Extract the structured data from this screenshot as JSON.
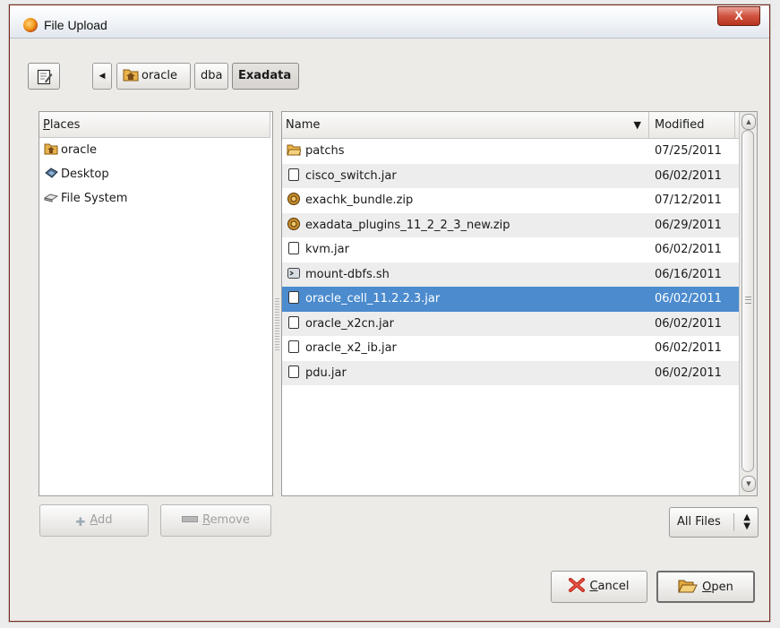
{
  "window": {
    "title": "File Upload",
    "close_label": "X"
  },
  "path_bar": {
    "crumbs": [
      {
        "label": "oracle"
      },
      {
        "label": "dba"
      },
      {
        "label": "Exadata"
      }
    ]
  },
  "places": {
    "header": "Places",
    "items": [
      {
        "label": "oracle",
        "icon": "home-folder-icon"
      },
      {
        "label": "Desktop",
        "icon": "desktop-icon"
      },
      {
        "label": "File System",
        "icon": "drive-icon"
      }
    ]
  },
  "files": {
    "columns": {
      "name": "Name",
      "modified": "Modified"
    },
    "rows": [
      {
        "name": "patchs",
        "modified": "07/25/2011",
        "icon": "folder-icon"
      },
      {
        "name": "cisco_switch.jar",
        "modified": "06/02/2011",
        "icon": "file-icon"
      },
      {
        "name": "exachk_bundle.zip",
        "modified": "07/12/2011",
        "icon": "archive-icon"
      },
      {
        "name": "exadata_plugins_11_2_2_3_new.zip",
        "modified": "06/29/2011",
        "icon": "archive-icon"
      },
      {
        "name": "kvm.jar",
        "modified": "06/02/2011",
        "icon": "file-icon"
      },
      {
        "name": "mount-dbfs.sh",
        "modified": "06/16/2011",
        "icon": "script-icon"
      },
      {
        "name": "oracle_cell_11.2.2.3.jar",
        "modified": "06/02/2011",
        "icon": "file-icon",
        "selected": true
      },
      {
        "name": "oracle_x2cn.jar",
        "modified": "06/02/2011",
        "icon": "file-icon"
      },
      {
        "name": "oracle_x2_ib.jar",
        "modified": "06/02/2011",
        "icon": "file-icon"
      },
      {
        "name": "pdu.jar",
        "modified": "06/02/2011",
        "icon": "file-icon"
      }
    ]
  },
  "buttons": {
    "add": {
      "accel": "A",
      "rest": "dd"
    },
    "remove": {
      "accel": "R",
      "rest": "emove"
    },
    "filter": "All Files",
    "cancel": {
      "accel": "C",
      "rest": "ancel"
    },
    "open": {
      "accel": "O",
      "rest": "pen"
    }
  },
  "colors": {
    "selection": "#4b8bce",
    "window_border": "#7a2a1c",
    "close_button": "#c9452f"
  }
}
